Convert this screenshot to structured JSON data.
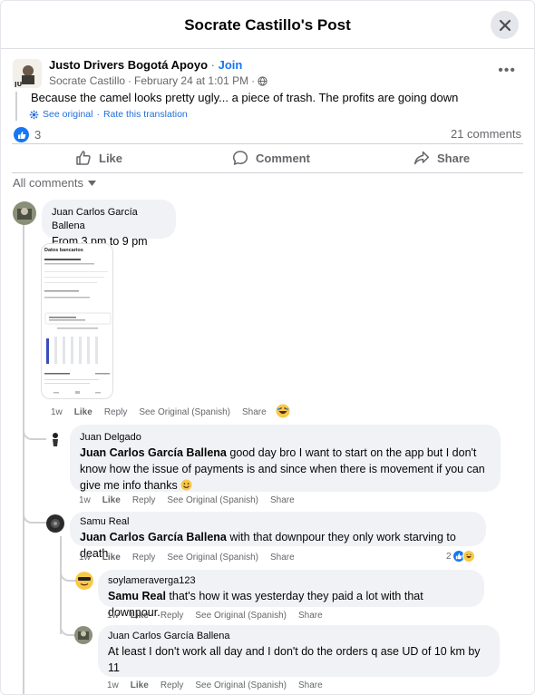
{
  "header": {
    "title": "Socrate Castillo's Post"
  },
  "post": {
    "group_name": "Justo Drivers Bogotá Apoyo",
    "join_label": "Join",
    "author": "Socrate Castillo",
    "date": "February 24 at 1:01 PM",
    "separator": "·",
    "text": "Because the camel looks pretty ugly... a piece of trash. The profits are going down",
    "see_original": "See original",
    "rate_translation": "Rate this translation",
    "reaction_count": "3",
    "comment_count": "21 comments",
    "actions": {
      "like": "Like",
      "comment": "Comment",
      "share": "Share"
    }
  },
  "filter": {
    "label": "All comments"
  },
  "comments": {
    "c1": {
      "name": "Juan Carlos García Ballena",
      "text": "From 3 pm to 9 pm",
      "time": "1w",
      "like": "Like",
      "reply": "Reply",
      "see_original": "See Original (Spanish)",
      "share": "Share",
      "screenshot": {
        "title": "Datos bancarios"
      }
    },
    "c2": {
      "name": "Juan Delgado",
      "tag": "Juan Carlos García Ballena",
      "text": " good day bro I want to start on the app but I don't know how the issue of payments is and since when there is movement if you can give me info thanks",
      "time": "1w",
      "like": "Like",
      "reply": "Reply",
      "see_original": "See Original (Spanish)",
      "share": "Share"
    },
    "c3": {
      "name": "Samu Real",
      "tag": "Juan Carlos García Ballena",
      "text": " with that downpour they only work starving to death",
      "time": "1w",
      "like": "Like",
      "reply": "Reply",
      "see_original": "See Original (Spanish)",
      "share": "Share",
      "reactions": "2"
    },
    "c4": {
      "name": "soylameraverga123",
      "tag": "Samu Real",
      "text": " that's how it was yesterday they paid a lot with that downpour.",
      "time": "1w",
      "like": "Like",
      "reply": "Reply",
      "see_original": "See Original (Spanish)",
      "share": "Share"
    },
    "c5": {
      "name": "Juan Carlos García Ballena",
      "text": "At least I don't work all day and I don't do the orders q ase UD of 10 km by 11",
      "time": "1w",
      "like": "Like",
      "reply": "Reply",
      "see_original": "See Original (Spanish)",
      "share": "Share"
    }
  },
  "colors": {
    "accent": "#1877f2",
    "muted": "#65676b",
    "bubble": "#f0f2f5"
  },
  "icons": [
    "close-icon",
    "globe-icon",
    "gear-icon",
    "like-icon",
    "comment-icon",
    "share-icon",
    "chevron-down-icon",
    "laugh-emoji-icon",
    "smile-emoji-icon"
  ]
}
